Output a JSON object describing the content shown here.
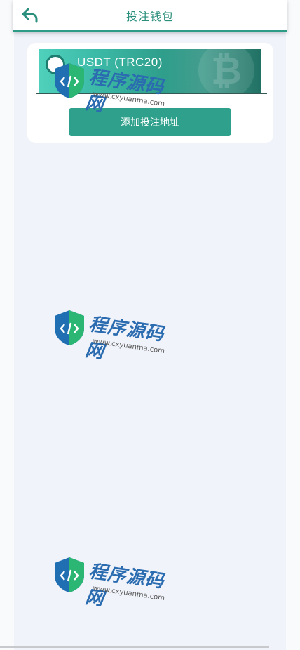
{
  "header": {
    "title": "投注钱包"
  },
  "wallet": {
    "name": "USDT (TRC20)",
    "add_button_label": "添加投注地址"
  },
  "watermark": {
    "text": "程序源码网",
    "url": "www.cxyuanma.com"
  },
  "colors": {
    "accent": "#2ea08b",
    "title": "#2a8f7c"
  }
}
